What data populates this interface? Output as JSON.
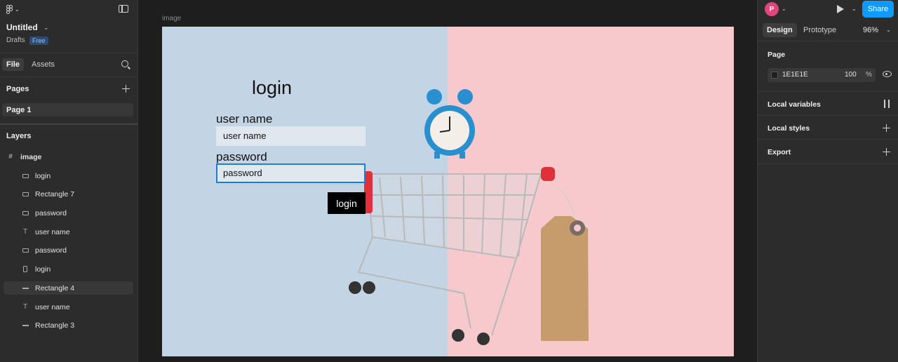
{
  "file": {
    "title": "Untitled",
    "location": "Drafts",
    "plan_badge": "Free"
  },
  "left_tabs": {
    "file": "File",
    "assets": "Assets"
  },
  "pages": {
    "heading": "Pages",
    "items": [
      {
        "label": "Page 1"
      }
    ]
  },
  "layers": {
    "heading": "Layers",
    "items": [
      {
        "label": "image",
        "icon": "frame-icon"
      },
      {
        "label": "login",
        "icon": "rectangle-icon"
      },
      {
        "label": "Rectangle 7",
        "icon": "rectangle-icon"
      },
      {
        "label": "password",
        "icon": "rectangle-icon"
      },
      {
        "label": "user name",
        "icon": "text-icon"
      },
      {
        "label": "password",
        "icon": "rectangle-icon"
      },
      {
        "label": "login",
        "icon": "tall-rectangle-icon"
      },
      {
        "label": "Rectangle 4",
        "icon": "line-icon"
      },
      {
        "label": "user name",
        "icon": "text-icon"
      },
      {
        "label": "Rectangle 3",
        "icon": "line-icon"
      }
    ]
  },
  "canvas": {
    "frame_label": "image",
    "design": {
      "heading": "login",
      "username_label": "user name",
      "username_value": "user name",
      "password_label": "password",
      "password_value": "password",
      "button_label": "login"
    }
  },
  "right_panel": {
    "avatar_initial": "P",
    "share_label": "Share",
    "tabs": {
      "design": "Design",
      "prototype": "Prototype"
    },
    "zoom": "96%",
    "page_heading": "Page",
    "page_color": "1E1E1E",
    "page_opacity": "100",
    "opacity_unit": "%",
    "local_variables": "Local variables",
    "local_styles": "Local styles",
    "export": "Export"
  },
  "colors": {
    "accent": "#0d99ff",
    "avatar": "#e0457b",
    "canvas": "#1e1e1e"
  }
}
